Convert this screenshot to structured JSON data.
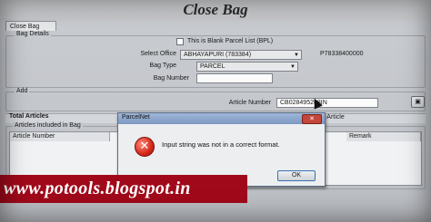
{
  "app": {
    "title": "Close Bag",
    "tab": "Close Bag"
  },
  "bag_details": {
    "legend": "Bag Details",
    "blank_parcel_label": "This is Blank Parcel List (BPL)",
    "office_label": "Select Office",
    "office_value": "ABHAYAPURI (783384)",
    "office_code": "P78338400000",
    "bag_type_label": "Bag Type",
    "bag_type_value": "PARCEL",
    "bag_number_label": "Bag Number",
    "bag_number_value": ""
  },
  "add": {
    "legend": "Add",
    "article_number_label": "Article Number",
    "article_number_value": "CB028495268IN"
  },
  "articles": {
    "total_label": "Total Articles",
    "search_label": "rch Article",
    "included_legend": "Articles included in Bag",
    "columns": [
      "Article Number",
      "Remark"
    ]
  },
  "dialog": {
    "title": "ParcelNet",
    "close_label": "✕",
    "message": "Input string was not in a correct format.",
    "ok_label": "OK"
  },
  "watermark": "www.potools.blogspot.in"
}
